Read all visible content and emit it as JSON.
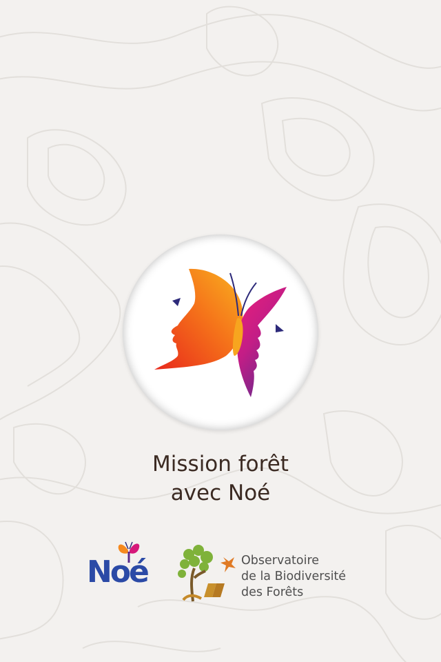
{
  "app": {
    "title_line1": "Mission forêt",
    "title_line2": "avec Noé"
  },
  "partners": {
    "noe": {
      "wordmark": "Noé"
    },
    "obf": {
      "line1": "Observatoire",
      "line2": "de la Biodiversité",
      "line3": "des Forêts"
    }
  },
  "colors": {
    "background": "#f3f1ef",
    "title": "#3b2a22",
    "noe_blue": "#2b4aa6",
    "orange": "#f39a1e",
    "magenta": "#d6187a"
  },
  "icons": {
    "main_logo": "butterfly-faces-logo",
    "noe_logo": "butterfly-icon",
    "obf_logo": "tree-icon"
  }
}
